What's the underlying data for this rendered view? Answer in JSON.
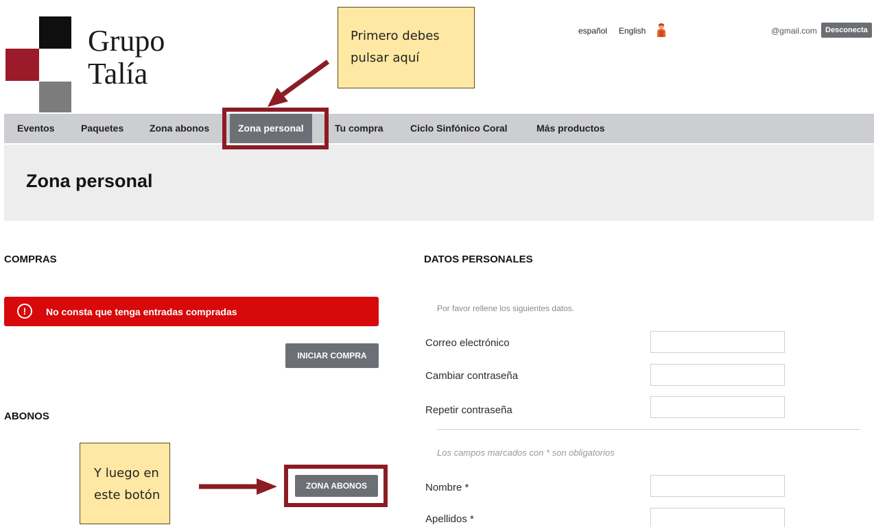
{
  "brand": {
    "line1": "Grupo",
    "line2": "Talía"
  },
  "topbar": {
    "languages": [
      "español",
      "English"
    ],
    "user_email": "@gmail.com",
    "logout_label": "Desconecta"
  },
  "annotations": {
    "first": "Primero debes pulsar aquí",
    "second": "Y luego en este botón"
  },
  "nav": {
    "items": [
      "Eventos",
      "Paquetes",
      "Zona abonos",
      "Zona personal",
      "Tu compra",
      "Ciclo Sinfónico Coral",
      "Más productos"
    ],
    "active_index": 3
  },
  "page": {
    "title": "Zona personal"
  },
  "purchases": {
    "heading": "COMPRAS",
    "alert_text": "No consta que tenga entradas compradas",
    "start_button": "INICIAR COMPRA"
  },
  "subscriptions": {
    "heading": "ABONOS",
    "button": "ZONA ABONOS"
  },
  "personal": {
    "heading": "DATOS PERSONALES",
    "hint": "Por favor rellene los siguientes datos.",
    "fields": [
      {
        "label": "Correo electrónico",
        "value": ""
      },
      {
        "label": "Cambiar contraseña",
        "value": ""
      },
      {
        "label": "Repetir contraseña",
        "value": ""
      }
    ],
    "required_note": "Los campos marcados con * son obligatorios",
    "required_fields": [
      {
        "label": "Nombre *",
        "value": ""
      },
      {
        "label": "Apellidos *",
        "value": ""
      }
    ]
  },
  "colors": {
    "accent_red": "#8c1c24",
    "alert_red": "#d7090b",
    "nav_bg": "#cdced2",
    "button_gray": "#6c7076",
    "callout_bg": "#ffe8a3"
  }
}
